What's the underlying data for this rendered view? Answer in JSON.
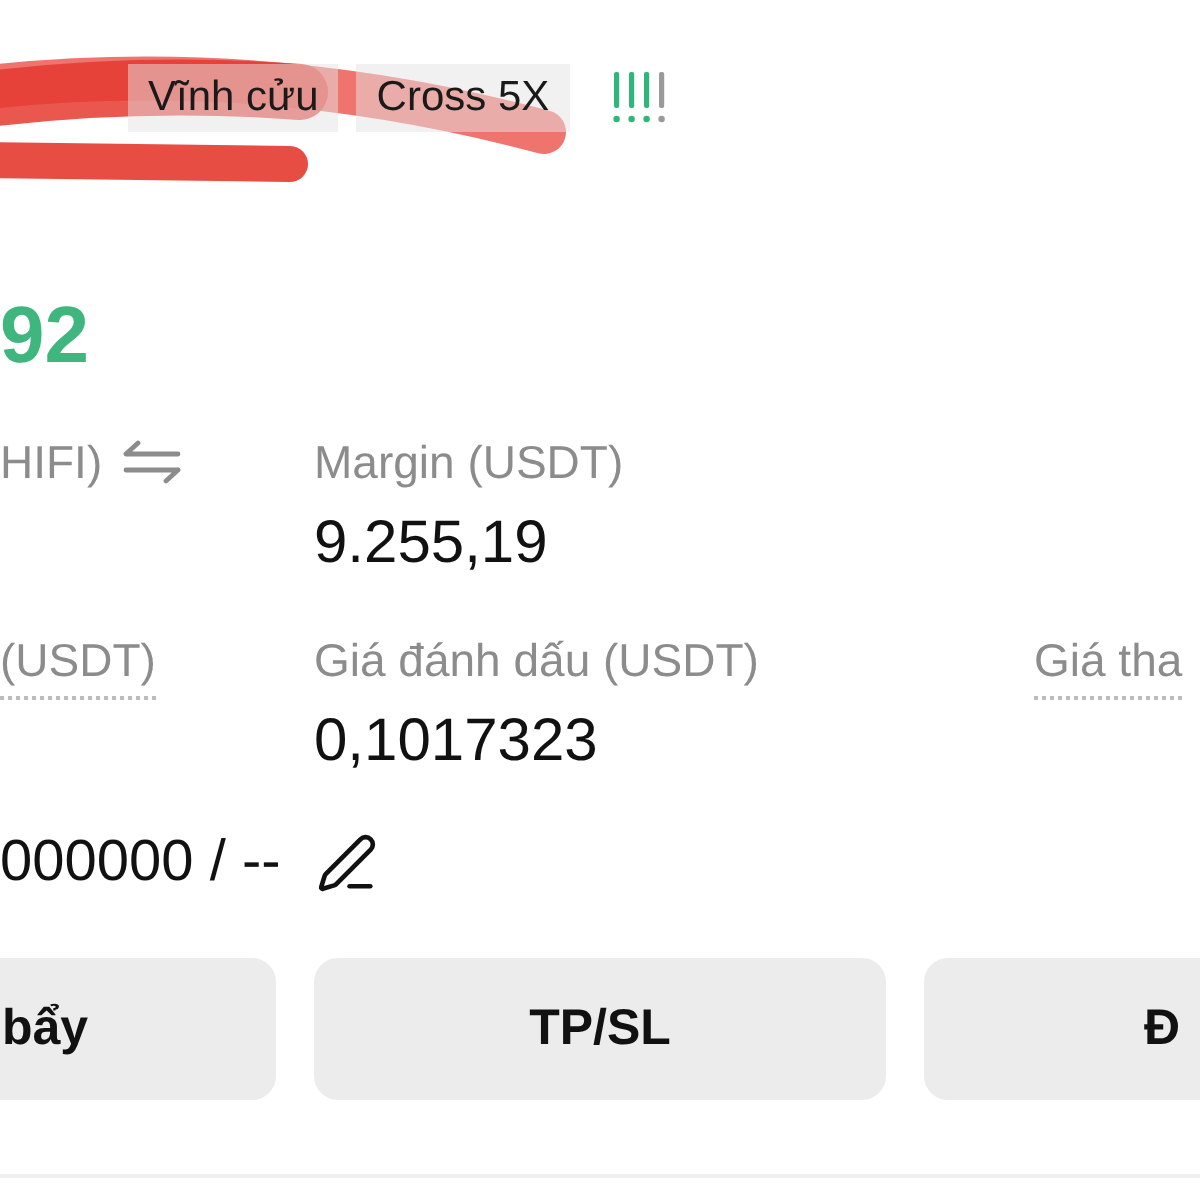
{
  "header": {
    "tags": [
      {
        "label": "Vĩnh cửu"
      },
      {
        "label": "Cross 5X"
      }
    ]
  },
  "pnl": {
    "value": "92"
  },
  "rows": [
    [
      {
        "label": "HIFI)",
        "kind": "swap"
      },
      {
        "label": "Margin (USDT)",
        "kind": "plain",
        "value": "9.255,19"
      }
    ],
    [
      {
        "label": "(USDT)",
        "kind": "dotted"
      },
      {
        "label": "Giá đánh dấu (USDT)",
        "kind": "plain",
        "value": "0,1017323"
      },
      {
        "label": "Giá tha",
        "kind": "dotted"
      }
    ]
  ],
  "tp_sl": {
    "text": "000000 / --"
  },
  "buttons": [
    {
      "label": "bẩy"
    },
    {
      "label": "TP/SL"
    },
    {
      "label": "Đ"
    }
  ]
}
